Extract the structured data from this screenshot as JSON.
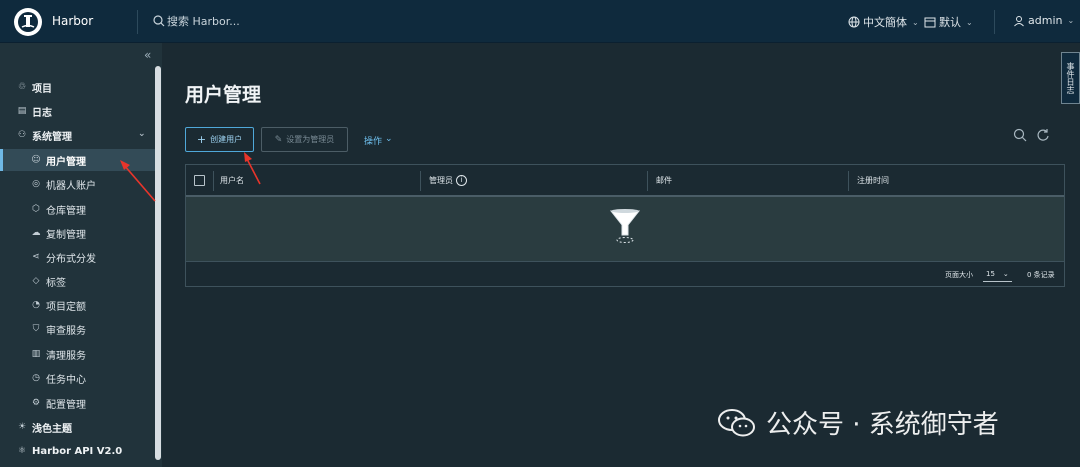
{
  "header": {
    "brand": "Harbor",
    "search_placeholder": "搜索 Harbor...",
    "language": "中文簡体",
    "datetime_format": "默认",
    "user": "admin"
  },
  "sidebar": {
    "items": [
      {
        "label": "项目",
        "icon": "projects-icon"
      },
      {
        "label": "日志",
        "icon": "logs-icon"
      },
      {
        "label": "系统管理",
        "icon": "admin-icon"
      },
      {
        "label": "用户管理",
        "icon": "users-icon"
      },
      {
        "label": "机器人账户",
        "icon": "robot-icon"
      },
      {
        "label": "仓库管理",
        "icon": "registry-icon"
      },
      {
        "label": "复制管理",
        "icon": "replication-icon"
      },
      {
        "label": "分布式分发",
        "icon": "distribution-icon"
      },
      {
        "label": "标签",
        "icon": "tag-icon"
      },
      {
        "label": "项目定额",
        "icon": "quota-icon"
      },
      {
        "label": "审查服务",
        "icon": "shield-icon"
      },
      {
        "label": "清理服务",
        "icon": "trash-icon"
      },
      {
        "label": "任务中心",
        "icon": "job-icon"
      },
      {
        "label": "配置管理",
        "icon": "config-icon"
      },
      {
        "label": "浅色主题",
        "icon": "sun-icon"
      },
      {
        "label": "Harbor API V2.0",
        "icon": "api-icon"
      }
    ]
  },
  "main": {
    "title": "用户管理",
    "create_user": "创建用户",
    "set_admin": "设置为管理员",
    "actions": "操作",
    "columns": [
      "用户名",
      "管理员",
      "邮件",
      "注册时间"
    ],
    "page_size_label": "页面大小",
    "page_size": "15",
    "record_count": "0 条记录"
  },
  "side_tab": "事件日志",
  "watermark": "公众号 · 系统御守者",
  "colors": {
    "accent": "#4fa8d9",
    "header_bg": "#0f2a3d",
    "arrow": "#e8352b"
  }
}
